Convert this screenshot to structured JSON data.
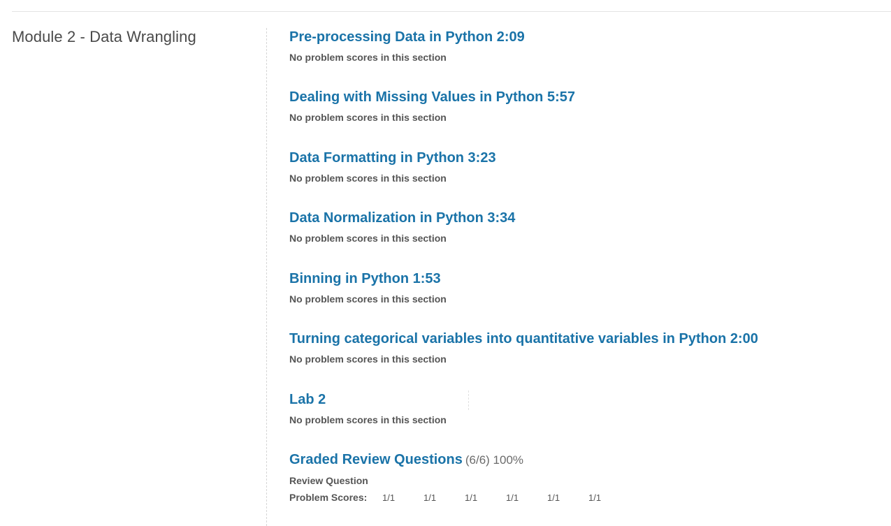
{
  "chapter": {
    "title": "Module 2 - Data Wrangling"
  },
  "sections": [
    {
      "title": "Pre-processing Data in Python 2:09",
      "note": "No problem scores in this section"
    },
    {
      "title": "Dealing with Missing Values in Python 5:57",
      "note": "No problem scores in this section"
    },
    {
      "title": "Data Formatting in Python 3:23",
      "note": "No problem scores in this section"
    },
    {
      "title": "Data Normalization in Python 3:34",
      "note": "No problem scores in this section"
    },
    {
      "title": "Binning in Python 1:53",
      "note": "No problem scores in this section"
    },
    {
      "title": "Turning categorical variables into quantitative variables in Python 2:00",
      "note": "No problem scores in this section"
    },
    {
      "title": "Lab 2",
      "note": "No problem scores in this section"
    }
  ],
  "graded": {
    "title": "Graded Review Questions",
    "score": "(6/6) 100%",
    "subsection": "Review Question",
    "scores_label": "Problem Scores:",
    "scores": [
      "1/1",
      "1/1",
      "1/1",
      "1/1",
      "1/1",
      "1/1"
    ]
  },
  "colors": {
    "link": "#1a73a8",
    "text": "#555555",
    "title": "#4a4a4a"
  }
}
